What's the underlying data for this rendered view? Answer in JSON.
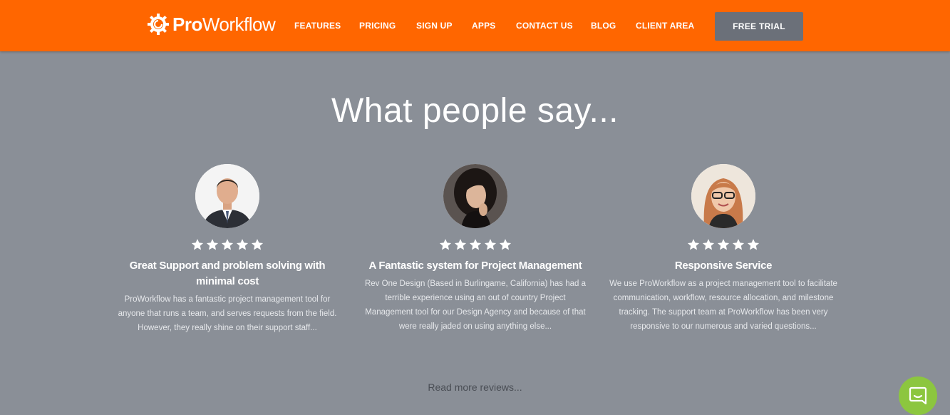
{
  "brand": {
    "name_bold": "Pro",
    "name_regular": "Workflow"
  },
  "nav": {
    "items": [
      {
        "label": "FEATURES"
      },
      {
        "label": "PRICING"
      },
      {
        "label": "SIGN UP"
      },
      {
        "label": "APPS"
      },
      {
        "label": "CONTACT US"
      },
      {
        "label": "BLOG"
      },
      {
        "label": "CLIENT AREA"
      }
    ],
    "cta_label": "FREE TRIAL"
  },
  "section": {
    "heading": "What people say...",
    "read_more": "Read more reviews..."
  },
  "testimonials": [
    {
      "rating": 5,
      "title": "Great Support and problem solving with minimal cost",
      "body": "ProWorkflow has a fantastic project management tool for anyone that runs a team, and serves requests from the field. However, they really shine on their support staff..."
    },
    {
      "rating": 5,
      "title": "A Fantastic system for Project Management",
      "body": "Rev One Design (Based in Burlingame, California) has had a terrible experience using an out of country Project Management tool for our Design Agency and because of that were really jaded on using anything else..."
    },
    {
      "rating": 5,
      "title": "Responsive Service",
      "body": "We use ProWorkflow as a project management tool to facilitate communication, workflow, resource allocation, and milestone tracking. The support team at ProWorkflow has been very responsive to our numerous and varied questions..."
    }
  ],
  "colors": {
    "nav_bg": "#ff6600",
    "page_bg": "#8a8f97",
    "cta_bg": "#6b7079",
    "chat_bg": "#8cc63f"
  },
  "icons": {
    "logo": "gear-logo-icon",
    "star": "star-icon",
    "chat": "chat-bubble-icon"
  }
}
